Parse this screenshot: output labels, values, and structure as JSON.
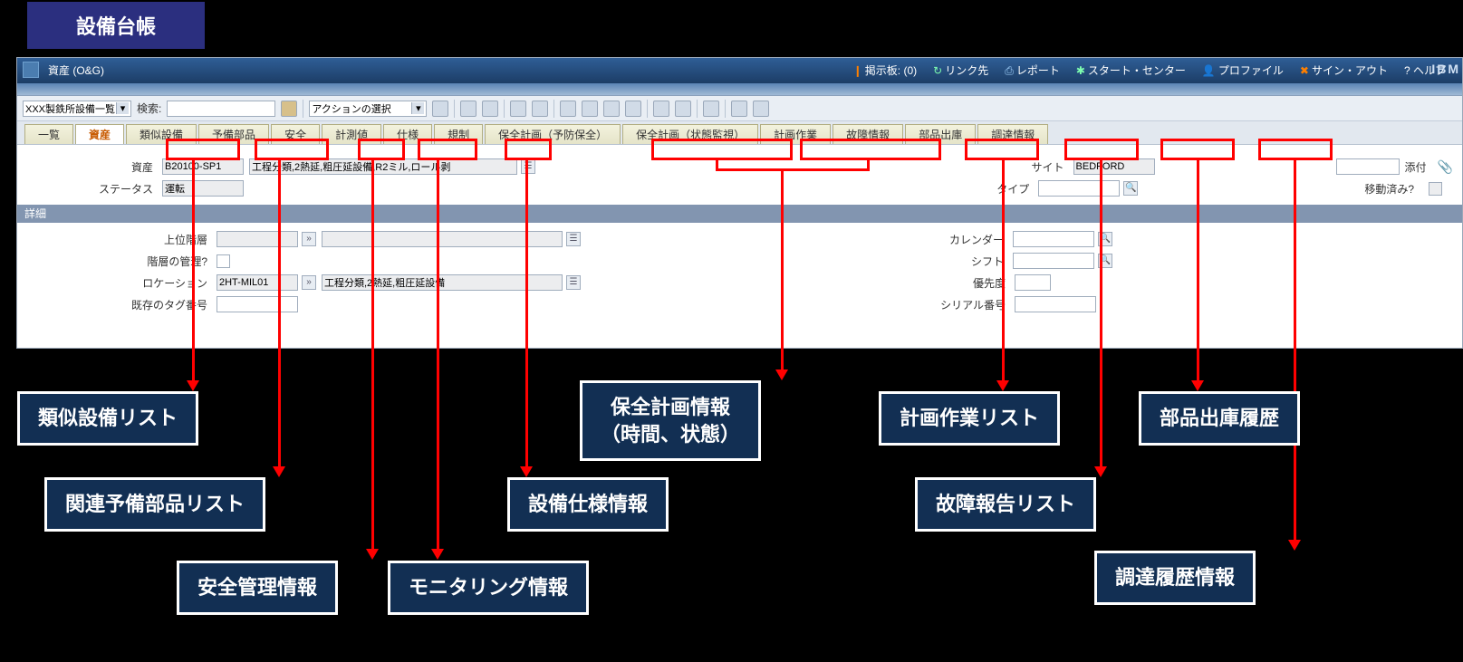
{
  "heading": "設備台帳",
  "menubar": {
    "title": "資産 (O&G)",
    "links": [
      "掲示板: (0)",
      "リンク先",
      "レポート",
      "スタート・センター",
      "プロファイル",
      "サイン・アウト",
      "ヘルプ"
    ],
    "ibm": "IBM"
  },
  "toolbar": {
    "query_select": "XXX製鉄所設備一覧",
    "search_label": "検索:",
    "action_select": "アクションの選択"
  },
  "tabs": [
    "一覧",
    "資産",
    "類似設備",
    "予備部品",
    "安全",
    "計測値",
    "仕様",
    "規制",
    "保全計画（予防保全）",
    "保全計画（状態監視）",
    "計画作業",
    "故障情報",
    "部品出庫",
    "調達情報"
  ],
  "tabs_active": 1,
  "form": {
    "asset_label": "資産",
    "asset_value": "B20100-SP1",
    "asset_desc": "工程分類,2熱延,粗圧延設備,R2ミル,ロール剥",
    "status_label": "ステータス",
    "status_value": "運転",
    "site_label": "サイト",
    "site_value": "BEDFORD",
    "attach_label": "添付",
    "type_label": "タイプ",
    "moved_label": "移動済み?"
  },
  "section_header": "詳細",
  "detail": {
    "parent_label": "上位階層",
    "managed_label": "階層の管理?",
    "location_label": "ロケーション",
    "location_value": "2HT-MIL01",
    "location_desc": "工程分類,2熱延,粗圧延設備",
    "tag_label": "既存のタグ番号",
    "calendar_label": "カレンダー",
    "shift_label": "シフト",
    "priority_label": "優先度",
    "serial_label": "シリアル番号"
  },
  "callouts": {
    "c1": "類似設備リスト",
    "c2": "関連予備部品リスト",
    "c3": "安全管理情報",
    "c4": "モニタリング情報",
    "c5": "設備仕様情報",
    "c6": "保全計画情報\n（時間、状態）",
    "c7": "計画作業リスト",
    "c8": "故障報告リスト",
    "c9": "部品出庫履歴",
    "c10": "調達履歴情報"
  }
}
